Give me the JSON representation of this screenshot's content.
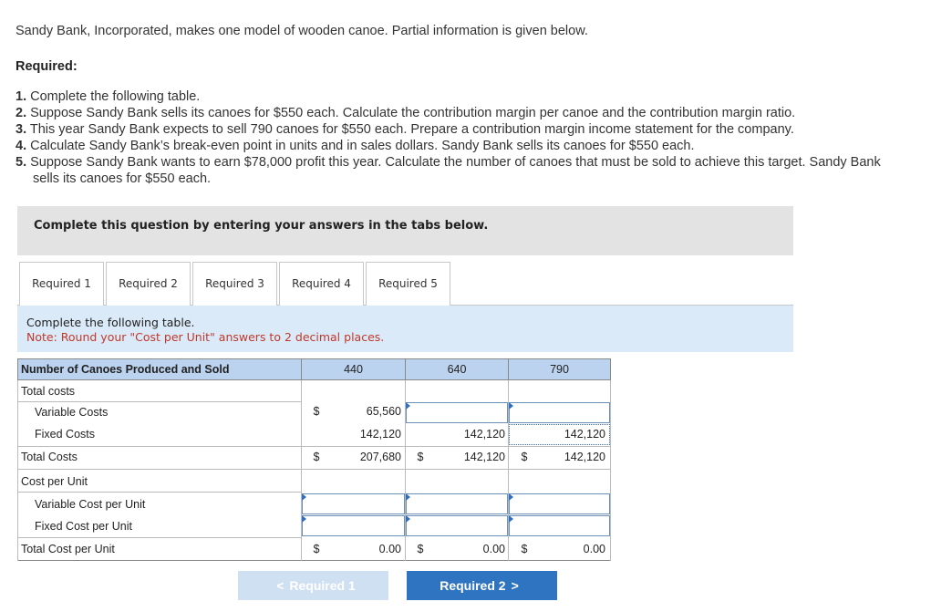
{
  "intro": "Sandy Bank, Incorporated, makes one model of wooden canoe. Partial information is given below.",
  "required_title": "Required:",
  "requirements": [
    {
      "num": "1.",
      "text": "Complete the following table."
    },
    {
      "num": "2.",
      "text": "Suppose Sandy Bank sells its canoes for $550 each. Calculate the contribution margin per canoe and the contribution margin ratio."
    },
    {
      "num": "3.",
      "text": "This year Sandy Bank expects to sell 790 canoes for $550 each. Prepare a contribution margin income statement for the company."
    },
    {
      "num": "4.",
      "text": "Calculate Sandy Bank’s break-even point in units and in sales dollars. Sandy Bank sells its canoes for $550 each."
    },
    {
      "num": "5.",
      "text": "Suppose Sandy Bank wants to earn $78,000 profit this year. Calculate the number of canoes that must be sold to achieve this target. Sandy Bank sells its canoes for $550 each."
    }
  ],
  "banner": "Complete this question by entering your answers in the tabs below.",
  "tabs": [
    "Required 1",
    "Required 2",
    "Required 3",
    "Required 4",
    "Required 5"
  ],
  "info": {
    "line1": "Complete the following table.",
    "line2": "Note: Round your \"Cost per Unit\" answers to 2 decimal places."
  },
  "table": {
    "header_label": "Number of Canoes Produced and Sold",
    "columns": [
      "440",
      "640",
      "790"
    ],
    "rows": {
      "total_costs_heading": "Total costs",
      "variable_costs": {
        "label": "Variable Costs",
        "values": [
          "65,560",
          "",
          ""
        ]
      },
      "fixed_costs": {
        "label": "Fixed Costs",
        "values": [
          "142,120",
          "142,120",
          "142,120"
        ]
      },
      "total_costs": {
        "label": "Total Costs",
        "values": [
          "207,680",
          "142,120",
          "142,120"
        ]
      },
      "cost_per_unit_heading": "Cost per Unit",
      "variable_cost_per_unit": {
        "label": "Variable Cost per Unit",
        "values": [
          "",
          "",
          ""
        ]
      },
      "fixed_cost_per_unit": {
        "label": "Fixed Cost per Unit",
        "values": [
          "",
          "",
          ""
        ]
      },
      "total_cost_per_unit": {
        "label": "Total Cost per Unit",
        "values": [
          "0.00",
          "0.00",
          "0.00"
        ]
      }
    },
    "currency": "$"
  },
  "nav": {
    "prev_label": "Required 1",
    "next_label": "Required 2",
    "prev_chevron": "<",
    "next_chevron": ">"
  },
  "colors": {
    "header_blue": "#bcd3ef",
    "info_blue": "#dbeaf8",
    "button_blue": "#2f74c0",
    "note_red": "#c0392b"
  }
}
